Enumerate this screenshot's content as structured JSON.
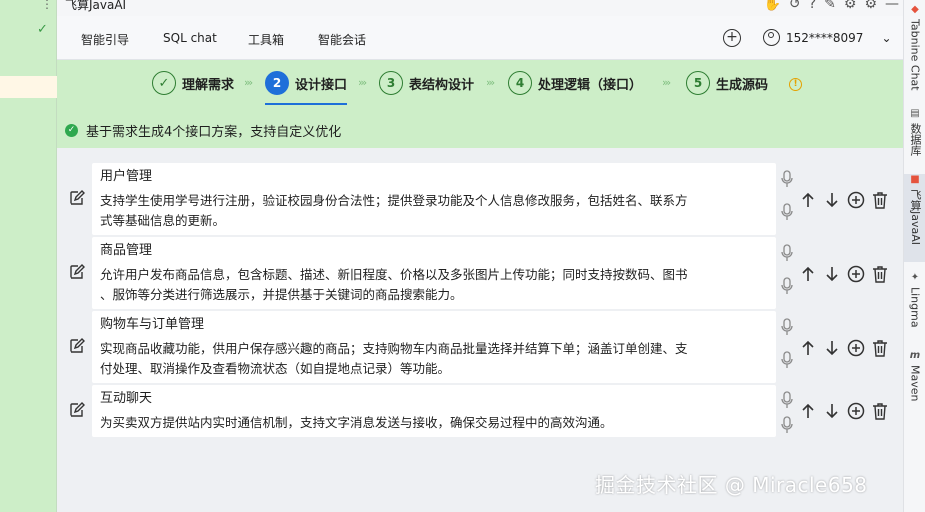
{
  "titlebar": {
    "title": "飞算JavaAI",
    "icons": [
      "hand-icon",
      "history-icon",
      "help-icon",
      "edit-icon",
      "settings-icon",
      "gear-icon",
      "minimize-icon"
    ]
  },
  "tabs": [
    {
      "label": "智能引导",
      "active": true
    },
    {
      "label": "SQL chat",
      "active": false
    },
    {
      "label": "工具箱",
      "active": false
    },
    {
      "label": "智能会话",
      "active": false
    }
  ],
  "user": {
    "phone": "152****8097"
  },
  "steps": [
    {
      "num": "✓",
      "label": "理解需求",
      "state": "done"
    },
    {
      "num": "2",
      "label": "设计接口",
      "state": "active"
    },
    {
      "num": "3",
      "label": "表结构设计",
      "state": "pending"
    },
    {
      "num": "4",
      "label": "处理逻辑（接口）",
      "state": "pending"
    },
    {
      "num": "5",
      "label": "生成源码",
      "state": "pending"
    }
  ],
  "notice": "基于需求生成4个接口方案，支持自定义优化",
  "interfaces": [
    {
      "name": "用户管理",
      "desc_lines": [
        "支持学生使用学号进行注册，验证校园身份合法性；提供登录功能及个人信息修改服务，包括姓名、联系方",
        "式等基础信息的更新。"
      ]
    },
    {
      "name": "商品管理",
      "desc_lines": [
        "允许用户发布商品信息，包含标题、描述、新旧程度、价格以及多张图片上传功能；同时支持按数码、图书",
        "、服饰等分类进行筛选展示，并提供基于关键词的商品搜索能力。"
      ]
    },
    {
      "name": "购物车与订单管理",
      "desc_lines": [
        "实现商品收藏功能，供用户保存感兴趣的商品；支持购物车内商品批量选择并结算下单；涵盖订单创建、支",
        "付处理、取消操作及查看物流状态（如自提地点记录）等功能。"
      ]
    },
    {
      "name": "互动聊天",
      "desc_lines": [
        "为买卖双方提供站内实时通信机制，支持文字消息发送与接收，确保交易过程中的高效沟通。"
      ]
    }
  ],
  "watermark": "掘金技术社区 @ Miracle658",
  "right_tools": [
    {
      "label": "Tabnine Chat"
    },
    {
      "label": "数据库"
    },
    {
      "label": "飞算JavaAI"
    },
    {
      "label": "Lingma"
    },
    {
      "label": "Maven"
    }
  ],
  "colors": {
    "accent": "#1e6fd9",
    "green_bg": "#cdeec8",
    "success": "#2fa84f",
    "warning": "#e5a100"
  }
}
